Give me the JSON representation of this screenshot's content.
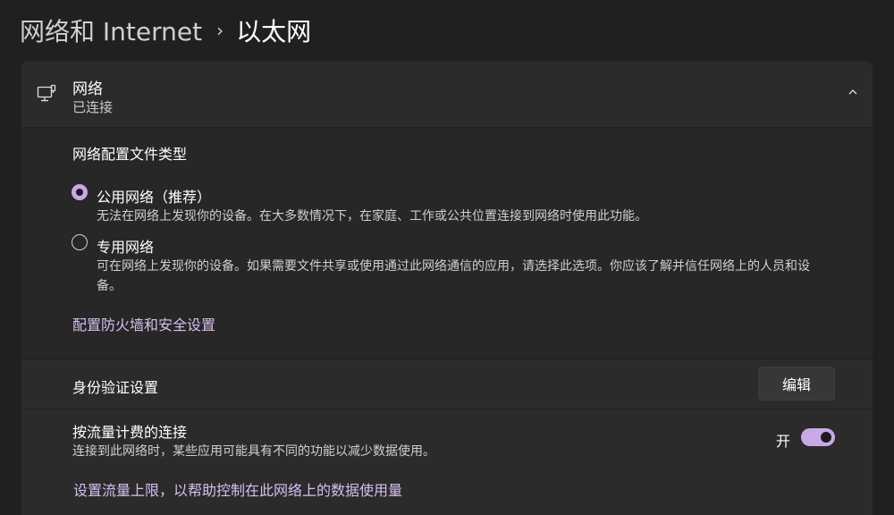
{
  "breadcrumb": {
    "parent": "网络和 Internet",
    "separator": "›",
    "current": "以太网"
  },
  "network_card": {
    "icon": "ethernet-monitor-icon",
    "title": "网络",
    "status": "已连接",
    "expanded": true
  },
  "profile": {
    "title": "网络配置文件类型",
    "options": [
      {
        "label": "公用网络（推荐）",
        "description": "无法在网络上发现你的设备。在大多数情况下，在家庭、工作或公共位置连接到网络时使用此功能。",
        "selected": true
      },
      {
        "label": "专用网络",
        "description": "可在网络上发现你的设备。如果需要文件共享或使用通过此网络通信的应用，请选择此选项。你应该了解并信任网络上的人员和设备。",
        "selected": false
      }
    ],
    "firewall_link": "配置防火墙和安全设置"
  },
  "auth": {
    "label": "身份验证设置",
    "button": "编辑"
  },
  "metered": {
    "label": "按流量计费的连接",
    "description": "连接到此网络时，某些应用可能具有不同的功能以减少数据使用。",
    "toggle_state": "开",
    "toggle_on": true,
    "data_limit_link": "设置流量上限，以帮助控制在此网络上的数据使用量"
  },
  "colors": {
    "background": "#202020",
    "card": "#2b2b2b",
    "accent": "#c8a9e6",
    "link": "#d6c0ef"
  }
}
